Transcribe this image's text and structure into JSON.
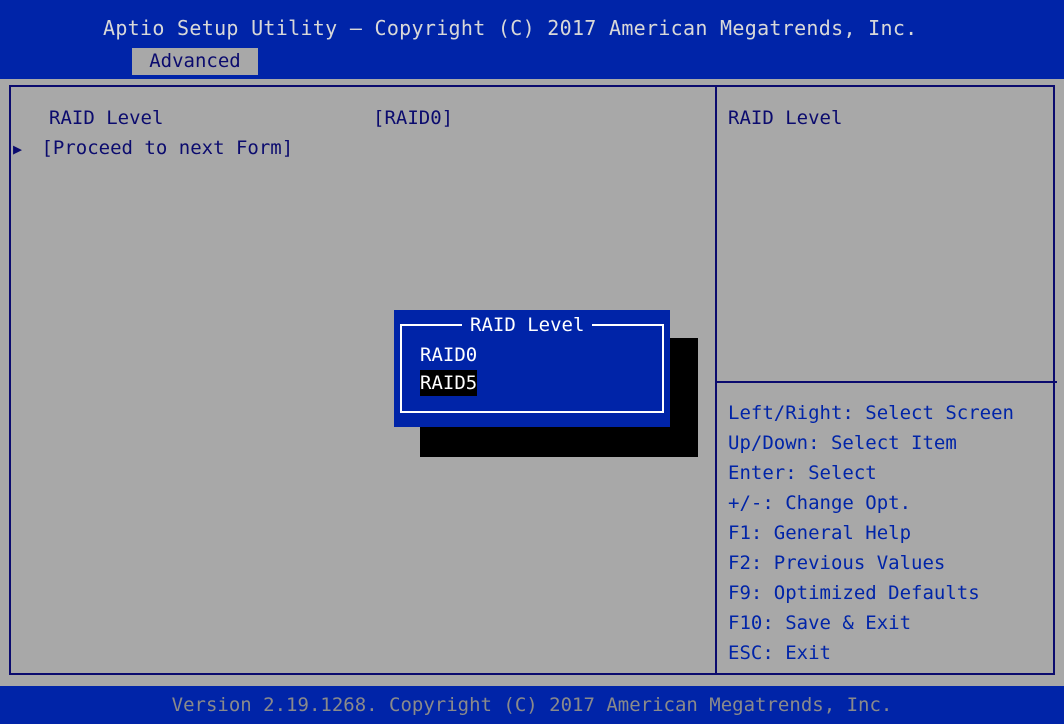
{
  "header": {
    "title": "Aptio Setup Utility – Copyright (C) 2017 American Megatrends, Inc.",
    "tab": "Advanced"
  },
  "settings": {
    "raid_label": "RAID Level",
    "raid_value": "[RAID0]",
    "proceed": "[Proceed to next Form]"
  },
  "help": {
    "title": "RAID Level",
    "keys": [
      "Left/Right: Select Screen",
      "Up/Down: Select Item",
      "Enter: Select",
      "+/-: Change Opt.",
      "F1: General Help",
      "F2: Previous Values",
      "F9: Optimized Defaults",
      "F10: Save & Exit",
      "ESC: Exit"
    ]
  },
  "popup": {
    "title": "RAID Level",
    "options": [
      "RAID0",
      "RAID5"
    ],
    "selected_index": 1
  },
  "footer": {
    "text": "Version 2.19.1268. Copyright (C) 2017 American Megatrends, Inc."
  }
}
